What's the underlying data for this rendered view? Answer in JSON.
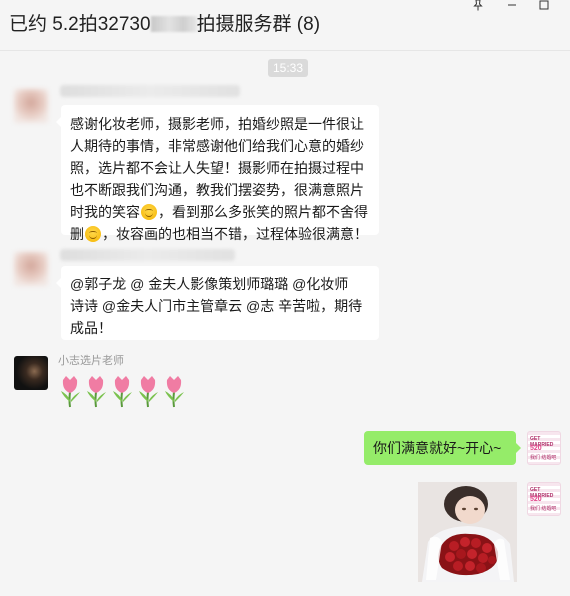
{
  "window": {
    "title_prefix": "已约 5.2拍32730",
    "title_suffix": "拍摄服务群 (8)",
    "pin_icon": "pin-icon",
    "minimize_icon": "minimize-icon",
    "maximize_icon": "maximize-icon"
  },
  "chat": {
    "timestamp": "15:33",
    "messages": [
      {
        "sender": "",
        "lines": [
          "感谢化妆老师，摄影老师，拍婚纱照是一件很让",
          "人期待的事情，非常感谢他们给我们心意的婚纱",
          "照，选片都不会让人失望！摄影师在拍摄过程中",
          "也不断跟我们沟通，教我们摆姿势，很满意照片",
          "时我的笑容",
          "，看到那么多张笑的照片都不舍得",
          "删",
          "，妆容画的也相当不错，过程体验很满意！"
        ]
      },
      {
        "sender": "",
        "lines": [
          "@郭子龙 @ 金夫人影像策划师璐璐 @化妆师",
          "诗诗 @金夫人门市主管章云 @志 辛苦啦，期待",
          "成品！"
        ]
      },
      {
        "sender": "小志选片老师",
        "tulip_count": 5
      },
      {
        "self": true,
        "text": "你们满意就好~开心~"
      },
      {
        "self": true,
        "image": "wedding-bouquet-photo"
      }
    ]
  },
  "self_avatar": {
    "line1": "GET MARRIED",
    "line2": "520",
    "line3": "我们 结婚吧"
  },
  "colors": {
    "window_bg": "#f5f5f5",
    "self_bubble": "#95ec69",
    "other_bubble": "#ffffff",
    "timestamp_bg": "#dadada"
  }
}
